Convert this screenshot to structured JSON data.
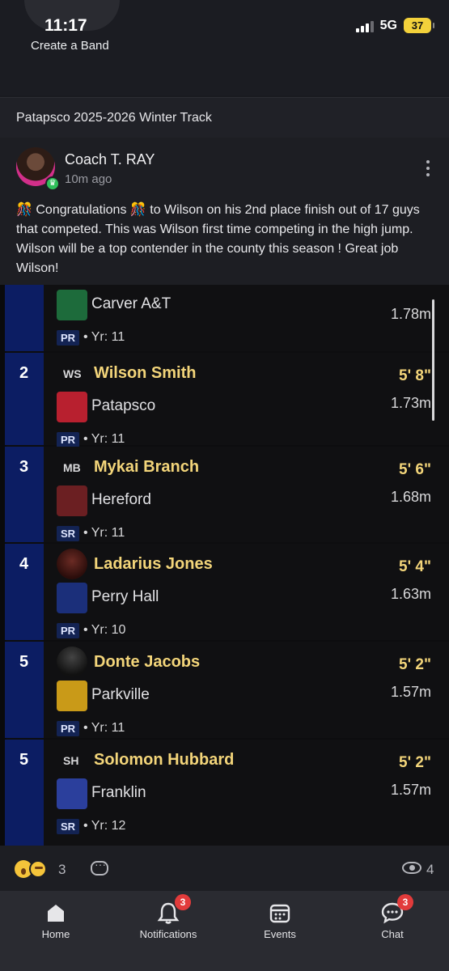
{
  "status": {
    "time": "11:17",
    "back_label": "Create a Band",
    "network": "5G",
    "battery": "37"
  },
  "band": {
    "title": "Patapsco 2025-2026 Winter Track"
  },
  "post": {
    "author": "Coach T. RAY",
    "time_ago": "10m ago",
    "text": "🎊 Congratulations 🎊  to Wilson on his 2nd place finish out of 17 guys that competed.  This was Wilson first time competing in the high jump. Wilson will be a top contender in the county this season ! Great job Wilson!"
  },
  "results": [
    {
      "rank": "",
      "initials": "",
      "name": "",
      "school": "Carver A&T",
      "mark_ft": "",
      "mark_m": "1.78m",
      "tag": "PR",
      "year": "• Yr: 11",
      "logo_color": "#1d6b3b"
    },
    {
      "rank": "2",
      "initials": "WS",
      "name": "Wilson Smith",
      "school": "Patapsco",
      "mark_ft": "5' 8\"",
      "mark_m": "1.73m",
      "tag": "PR",
      "year": "• Yr: 11",
      "logo_color": "#b8202f"
    },
    {
      "rank": "3",
      "initials": "MB",
      "name": "Mykai Branch",
      "school": "Hereford",
      "mark_ft": "5' 6\"",
      "mark_m": "1.68m",
      "tag": "SR",
      "year": "• Yr: 11",
      "logo_color": "#6b1f22"
    },
    {
      "rank": "4",
      "initials": "",
      "name": "Ladarius Jones",
      "school": "Perry Hall",
      "mark_ft": "5' 4\"",
      "mark_m": "1.63m",
      "tag": "PR",
      "year": "• Yr: 10",
      "logo_color": "#1b2f7a"
    },
    {
      "rank": "5",
      "initials": "",
      "name": "Donte Jacobs",
      "school": "Parkville",
      "mark_ft": "5' 2\"",
      "mark_m": "1.57m",
      "tag": "PR",
      "year": "• Yr: 11",
      "logo_color": "#c99a18"
    },
    {
      "rank": "5",
      "initials": "SH",
      "name": "Solomon Hubbard",
      "school": "Franklin",
      "mark_ft": "5' 2\"",
      "mark_m": "1.57m",
      "tag": "SR",
      "year": "• Yr: 12",
      "logo_color": "#2b3f9c"
    }
  ],
  "reactions": {
    "count": "3",
    "views": "4"
  },
  "nav": [
    {
      "label": "Home",
      "icon": "home-icon",
      "badge": ""
    },
    {
      "label": "Notifications",
      "icon": "bell-icon",
      "badge": "3"
    },
    {
      "label": "Events",
      "icon": "calendar-icon",
      "badge": ""
    },
    {
      "label": "Chat",
      "icon": "chat-icon",
      "badge": "3"
    }
  ]
}
